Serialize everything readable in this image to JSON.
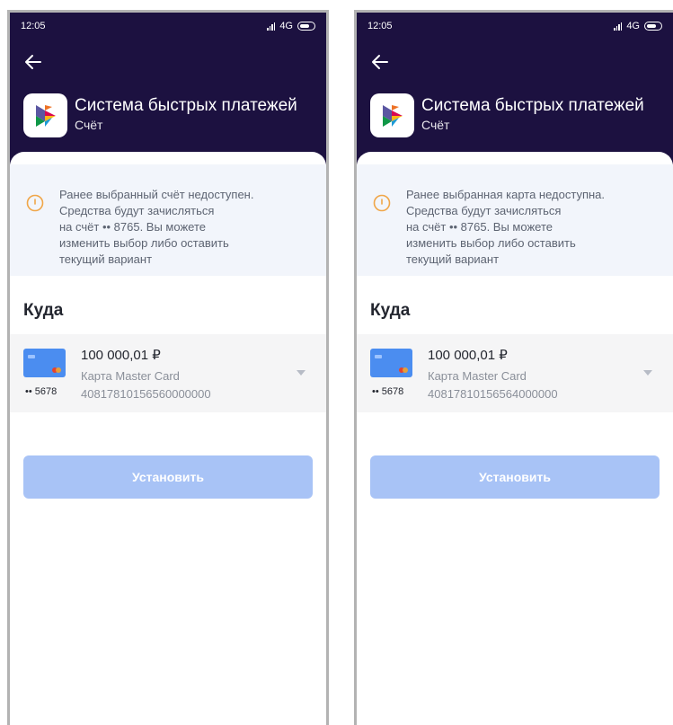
{
  "screens": [
    {
      "status": {
        "time": "12:05",
        "network": "4G"
      },
      "header": {
        "title": "Система быстрых платежей",
        "subtitle": "Счёт"
      },
      "notice": {
        "lines": [
          "Ранее выбранный счёт недоступен.",
          "Средства будут зачисляться",
          "на счёт •• 8765. Вы можете",
          "изменить выбор либо оставить",
          "текущий вариант"
        ]
      },
      "section_title": "Куда",
      "account": {
        "amount": "100 000,01 ₽",
        "card_name": "Карта Master Card",
        "account_number": "40817810156560000000",
        "card_mask": "•• 5678"
      },
      "button_label": "Установить"
    },
    {
      "status": {
        "time": "12:05",
        "network": "4G"
      },
      "header": {
        "title": "Система быстрых платежей",
        "subtitle": "Счёт"
      },
      "notice": {
        "lines": [
          "Ранее выбранная карта недоступна.",
          "Средства будут зачисляться",
          "на счёт •• 8765. Вы можете",
          "изменить выбор либо оставить",
          "текущий вариант"
        ]
      },
      "section_title": "Куда",
      "account": {
        "amount": "100 000,01 ₽",
        "card_name": "Карта Master Card",
        "account_number": "40817810156564000000",
        "card_mask": "•• 5678"
      },
      "button_label": "Установить"
    }
  ],
  "icons": {
    "back": "arrow-left-icon",
    "logo": "sbp-logo-icon",
    "warning": "info-circle-icon",
    "card": "card-icon",
    "chevron": "chevron-down-icon",
    "signal": "signal-icon",
    "battery": "battery-icon"
  },
  "colors": {
    "header_bg": "#1c1140",
    "notice_bg": "#f2f5fb",
    "button_bg": "#a8c3f6",
    "card_bg": "#4b8df0",
    "warning": "#f0a648"
  }
}
